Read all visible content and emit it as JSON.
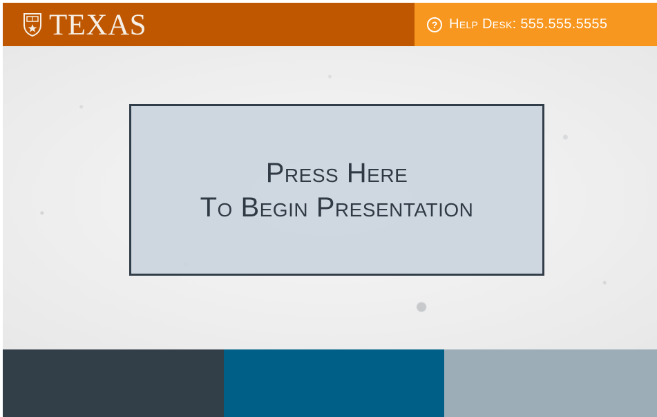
{
  "header": {
    "brand": "TEXAS",
    "seal_icon": "university-seal-icon",
    "help_icon": "question-circle-icon",
    "help_icon_glyph": "?",
    "help_text": "Help Desk: 555.555.5555"
  },
  "main": {
    "button_line_1": "Press Here",
    "button_line_2": "To Begin Presentation"
  },
  "colors": {
    "brand_orange": "#bf5700",
    "help_orange": "#f8971f",
    "button_fill": "#cbd4de",
    "button_border": "#313d49",
    "footer_bar_1": "#333f48",
    "footer_bar_2": "#005f86",
    "footer_bar_3": "#9cadb7"
  }
}
